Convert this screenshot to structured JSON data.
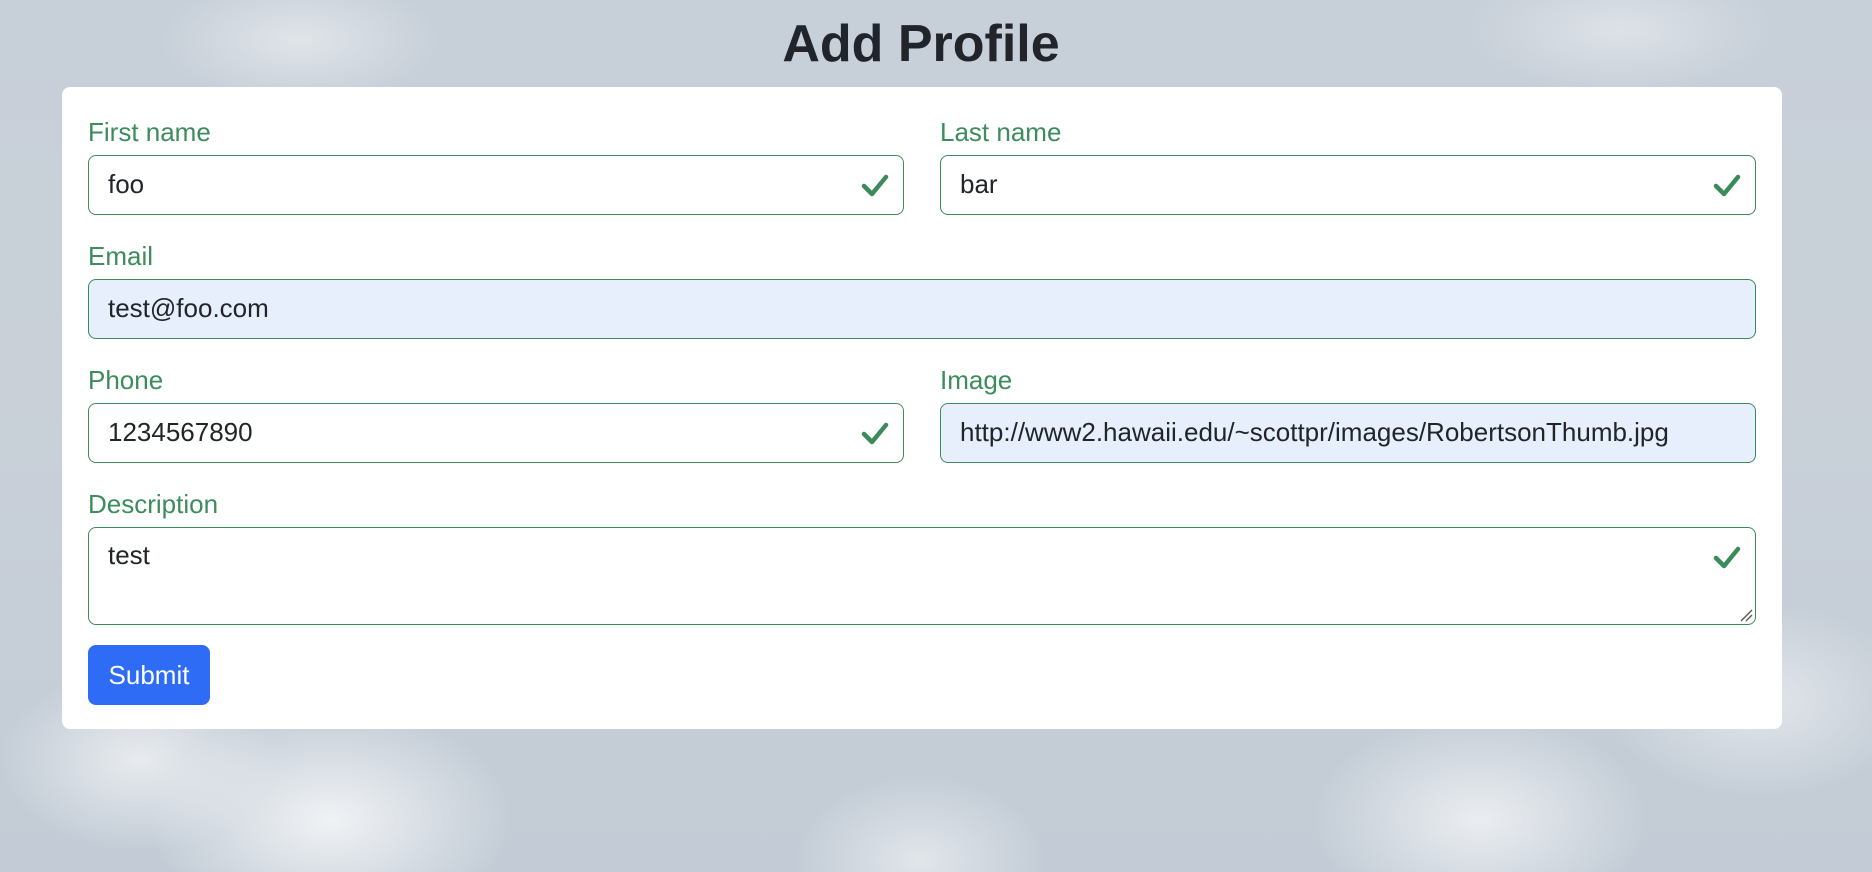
{
  "page": {
    "title": "Add Profile"
  },
  "form": {
    "first_name": {
      "label": "First name",
      "value": "foo",
      "valid": true
    },
    "last_name": {
      "label": "Last name",
      "value": "bar",
      "valid": true
    },
    "email": {
      "label": "Email",
      "value": "test@foo.com",
      "autofilled": true
    },
    "phone": {
      "label": "Phone",
      "value": "1234567890",
      "valid": true
    },
    "image": {
      "label": "Image",
      "value": "http://www2.hawaii.edu/~scottpr/images/RobertsonThumb.jpg",
      "autofilled": true
    },
    "description": {
      "label": "Description",
      "value": "test",
      "valid": true
    },
    "submit_label": "Submit"
  },
  "colors": {
    "valid_green": "#3a8a5a",
    "label_green": "#3c8c5c",
    "submit_blue": "#2f6cf5",
    "autofill_bg": "#e8effc",
    "title_text": "#212529"
  },
  "icons": {
    "valid": "check-icon",
    "resize": "resize-handle-icon"
  }
}
